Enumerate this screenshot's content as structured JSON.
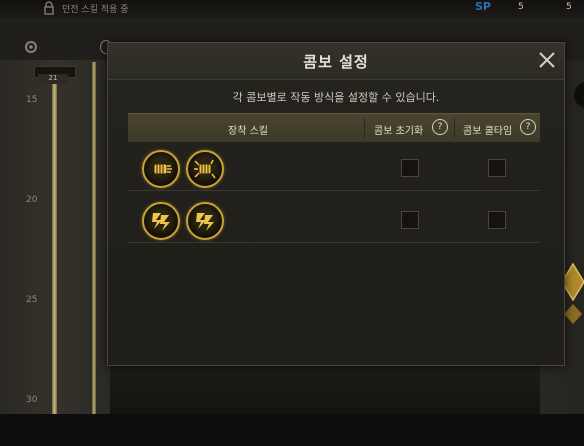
{
  "topbar": {
    "title": "던전 스킬 적용 중",
    "sp_label": "SP",
    "value1": "5",
    "value2": "5"
  },
  "background": {
    "level_ticks": [
      "15",
      "20",
      "25",
      "30"
    ],
    "rail_cap_label": "21"
  },
  "modal": {
    "title": "콤보 설정",
    "description": "각 콤보별로 작동 방식을 설정할 수 있습니다.",
    "columns": {
      "equipped_skill": "장착 스킬",
      "combo_reset": "콤보 초기화",
      "combo_cooltime": "콤보 쿨타임"
    },
    "rows": [
      {
        "skills": [
          "fist-strike-icon",
          "fist-burst-icon"
        ],
        "combo_reset": false,
        "combo_cooltime": false
      },
      {
        "skills": [
          "lightning-claw-icon",
          "lightning-claw-icon"
        ],
        "combo_reset": false,
        "combo_cooltime": false
      }
    ]
  },
  "colors": {
    "accent_gold": "#c7a23a",
    "header_bar": "#4a4530",
    "panel_bg": "#22211c"
  }
}
